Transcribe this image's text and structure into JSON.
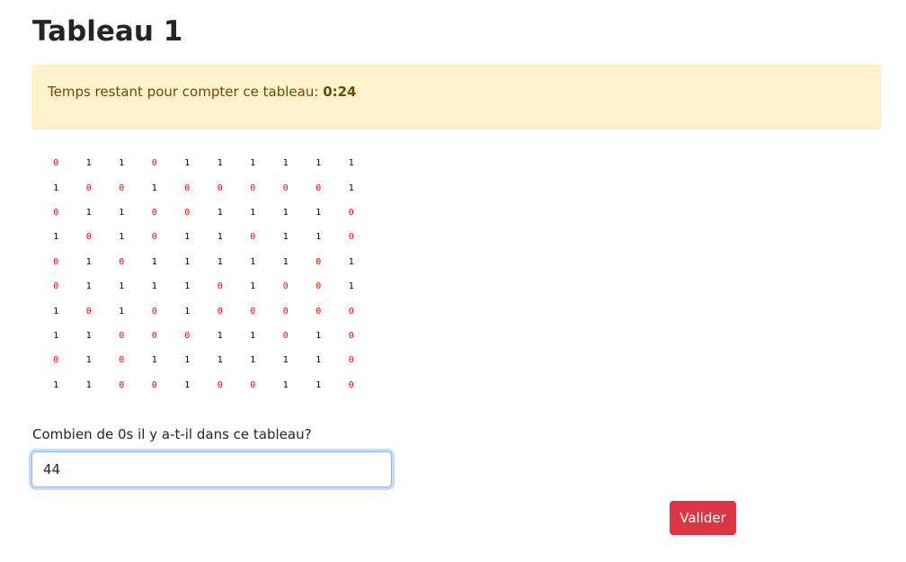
{
  "page": {
    "title": "Tableau 1"
  },
  "timer": {
    "label": "Temps restant pour compter ce tableau:",
    "value": "0:24"
  },
  "table": {
    "zero_color": "#ff0000",
    "one_color": "#000000",
    "rows": [
      [
        "0",
        "1",
        "1",
        "0",
        "1",
        "1",
        "1",
        "1",
        "1",
        "1"
      ],
      [
        "1",
        "0",
        "0",
        "1",
        "0",
        "0",
        "0",
        "0",
        "0",
        "1"
      ],
      [
        "0",
        "1",
        "1",
        "0",
        "0",
        "1",
        "1",
        "1",
        "1",
        "0"
      ],
      [
        "1",
        "0",
        "1",
        "0",
        "1",
        "1",
        "0",
        "1",
        "1",
        "0"
      ],
      [
        "0",
        "1",
        "0",
        "1",
        "1",
        "1",
        "1",
        "1",
        "0",
        "1"
      ],
      [
        "0",
        "1",
        "1",
        "1",
        "1",
        "0",
        "1",
        "0",
        "0",
        "1"
      ],
      [
        "1",
        "0",
        "1",
        "0",
        "1",
        "0",
        "0",
        "0",
        "0",
        "0"
      ],
      [
        "1",
        "1",
        "0",
        "0",
        "0",
        "1",
        "1",
        "0",
        "1",
        "0"
      ],
      [
        "0",
        "1",
        "0",
        "1",
        "1",
        "1",
        "1",
        "1",
        "1",
        "0"
      ],
      [
        "1",
        "1",
        "0",
        "0",
        "1",
        "0",
        "0",
        "1",
        "1",
        "0"
      ]
    ]
  },
  "form": {
    "question": "Combien de 0s il y a-t-il dans ce tableau?",
    "answer_value": "44",
    "submit_label": "Valider",
    "submit_color": "#dc3545"
  }
}
